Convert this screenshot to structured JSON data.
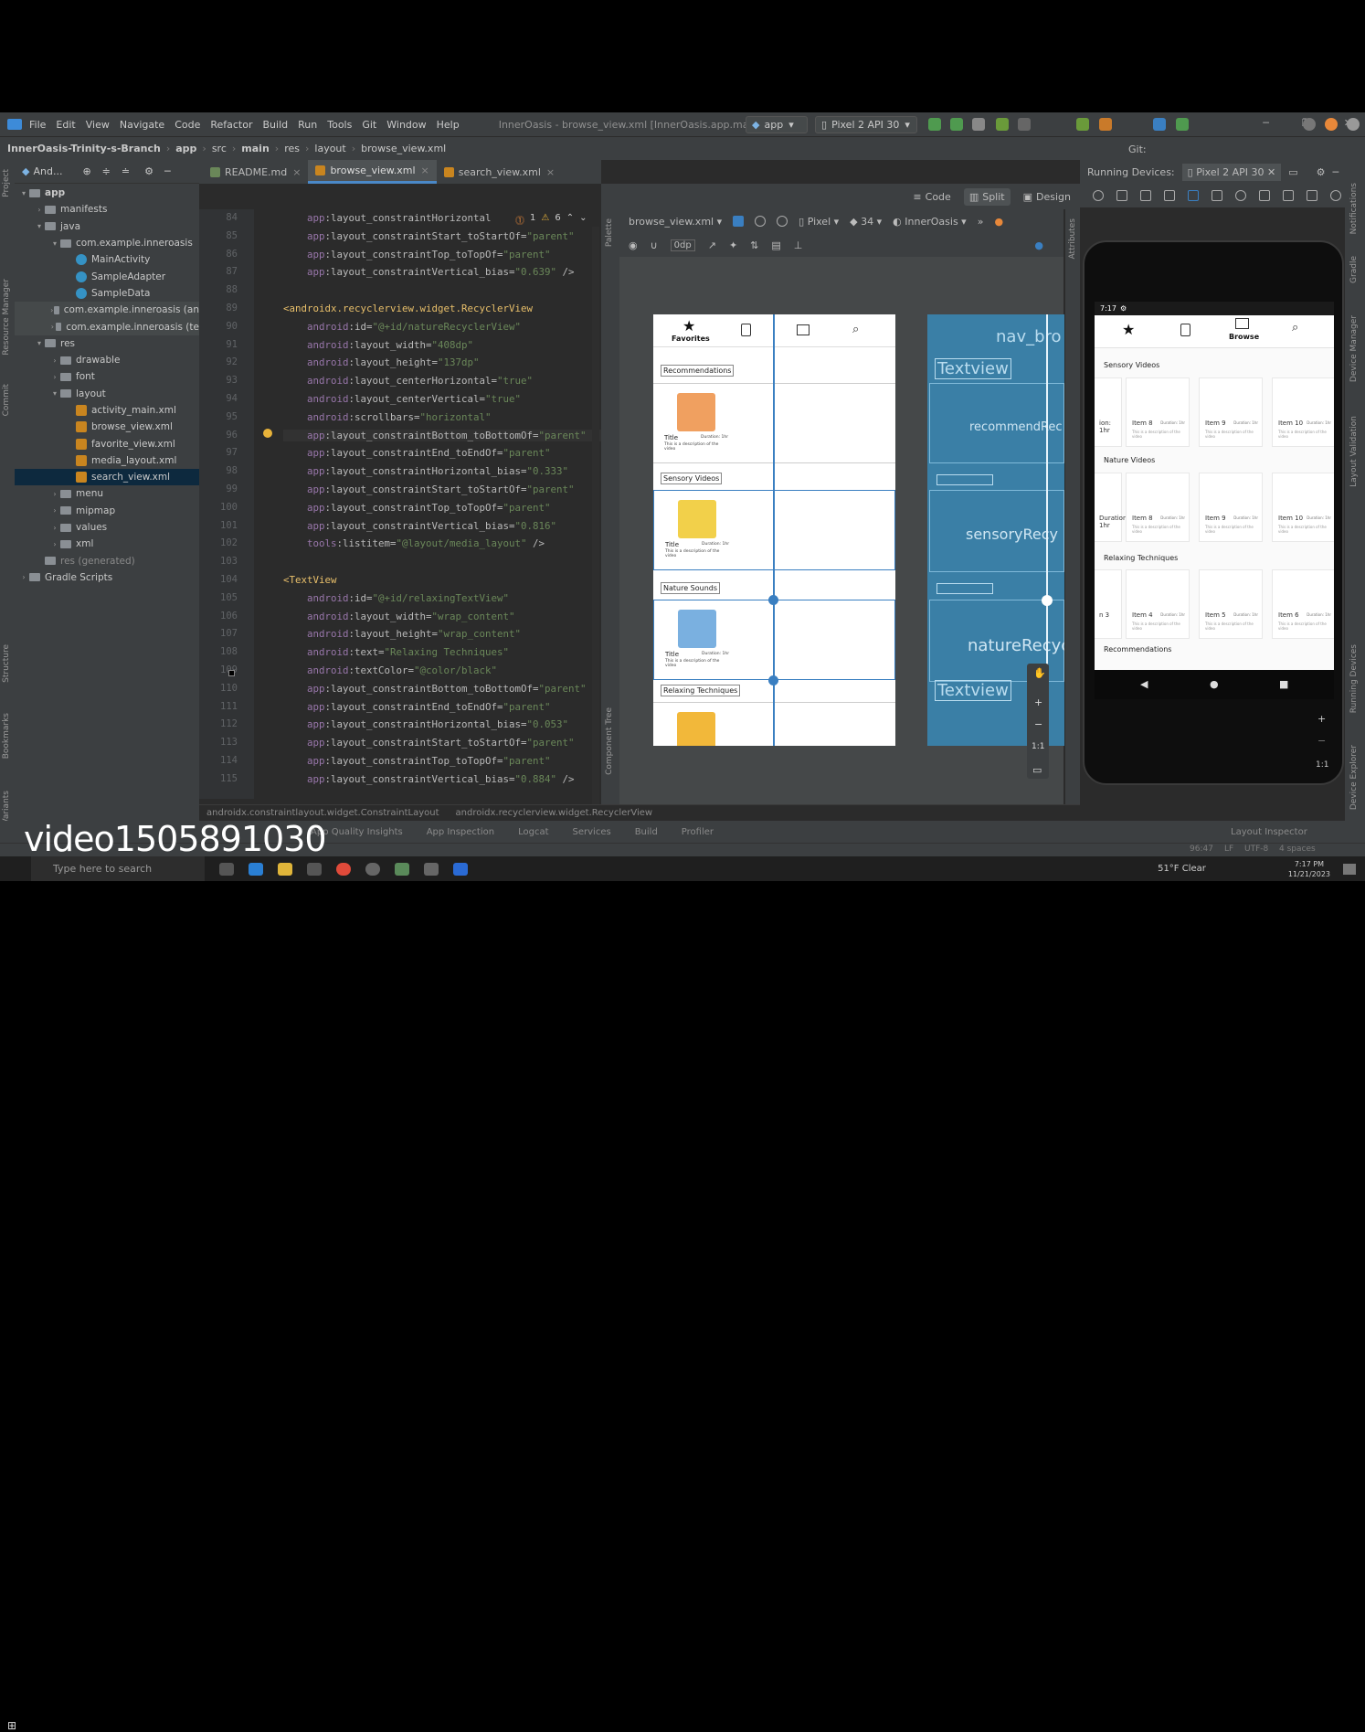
{
  "menu": {
    "items": [
      "File",
      "Edit",
      "View",
      "Navigate",
      "Code",
      "Refactor",
      "Build",
      "Run",
      "Tools",
      "Git",
      "Window",
      "Help"
    ],
    "window_title": "InnerOasis - browse_view.xml [InnerOasis.app.main]"
  },
  "nav": {
    "crumbs": [
      "InnerOasis-Trinity-s-Branch",
      "app",
      "src",
      "main",
      "res",
      "layout",
      "browse_view.xml"
    ],
    "run_config": "app",
    "device": "Pixel 2 API 30",
    "git": "Git:"
  },
  "project": {
    "header": "And...",
    "items": [
      {
        "label": "app",
        "depth": 0,
        "arrow": "v",
        "type": "folder",
        "bold": true
      },
      {
        "label": "manifests",
        "depth": 1,
        "arrow": ">",
        "type": "folder"
      },
      {
        "label": "java",
        "depth": 1,
        "arrow": "v",
        "type": "folder"
      },
      {
        "label": "com.example.inneroasis",
        "depth": 2,
        "arrow": "v",
        "type": "folder"
      },
      {
        "label": "MainActivity",
        "depth": 3,
        "arrow": "",
        "type": "class"
      },
      {
        "label": "SampleAdapter",
        "depth": 3,
        "arrow": "",
        "type": "class"
      },
      {
        "label": "SampleData",
        "depth": 3,
        "arrow": "",
        "type": "class"
      },
      {
        "label": "com.example.inneroasis (an",
        "depth": 2,
        "arrow": ">",
        "type": "folder",
        "hl": true
      },
      {
        "label": "com.example.inneroasis (te",
        "depth": 2,
        "arrow": ">",
        "type": "folder",
        "hl": true
      },
      {
        "label": "res",
        "depth": 1,
        "arrow": "v",
        "type": "folder"
      },
      {
        "label": "drawable",
        "depth": 2,
        "arrow": ">",
        "type": "folder"
      },
      {
        "label": "font",
        "depth": 2,
        "arrow": ">",
        "type": "folder"
      },
      {
        "label": "layout",
        "depth": 2,
        "arrow": "v",
        "type": "folder"
      },
      {
        "label": "activity_main.xml",
        "depth": 3,
        "arrow": "",
        "type": "xml"
      },
      {
        "label": "browse_view.xml",
        "depth": 3,
        "arrow": "",
        "type": "xml"
      },
      {
        "label": "favorite_view.xml",
        "depth": 3,
        "arrow": "",
        "type": "xml"
      },
      {
        "label": "media_layout.xml",
        "depth": 3,
        "arrow": "",
        "type": "xml"
      },
      {
        "label": "search_view.xml",
        "depth": 3,
        "arrow": "",
        "type": "xml",
        "sel": true
      },
      {
        "label": "menu",
        "depth": 2,
        "arrow": ">",
        "type": "folder"
      },
      {
        "label": "mipmap",
        "depth": 2,
        "arrow": ">",
        "type": "folder"
      },
      {
        "label": "values",
        "depth": 2,
        "arrow": ">",
        "type": "folder"
      },
      {
        "label": "xml",
        "depth": 2,
        "arrow": ">",
        "type": "folder"
      },
      {
        "label": "res (generated)",
        "depth": 1,
        "arrow": "",
        "type": "folder",
        "dim": true
      },
      {
        "label": "Gradle Scripts",
        "depth": 0,
        "arrow": ">",
        "type": "folder"
      }
    ]
  },
  "tabs": [
    {
      "label": "README.md",
      "active": false
    },
    {
      "label": "browse_view.xml",
      "active": true
    },
    {
      "label": "search_view.xml",
      "active": false
    }
  ],
  "warnings": {
    "errors": "1",
    "warns": "6"
  },
  "code": [
    {
      "n": "84",
      "parts": [
        [
          "ns",
          "    app"
        ],
        [
          "at",
          ":layout_constraintHorizontal"
        ]
      ]
    },
    {
      "n": "85",
      "parts": [
        [
          "ns",
          "    app"
        ],
        [
          "at",
          ":layout_constraintStart_toStartOf="
        ],
        [
          "vl",
          "\"parent\""
        ]
      ]
    },
    {
      "n": "86",
      "parts": [
        [
          "ns",
          "    app"
        ],
        [
          "at",
          ":layout_constraintTop_toTopOf="
        ],
        [
          "vl",
          "\"parent\""
        ]
      ]
    },
    {
      "n": "87",
      "parts": [
        [
          "ns",
          "    app"
        ],
        [
          "at",
          ":layout_constraintVertical_bias="
        ],
        [
          "vl",
          "\"0.639\""
        ],
        [
          "at",
          " />"
        ]
      ]
    },
    {
      "n": "88",
      "parts": [
        [
          "at",
          ""
        ]
      ]
    },
    {
      "n": "89",
      "parts": [
        [
          "tg",
          "<androidx.recyclerview.widget.RecyclerView"
        ]
      ]
    },
    {
      "n": "90",
      "parts": [
        [
          "ns",
          "    android"
        ],
        [
          "at",
          ":id="
        ],
        [
          "vl",
          "\"@+id/natureRecyclerView\""
        ]
      ]
    },
    {
      "n": "91",
      "parts": [
        [
          "ns",
          "    android"
        ],
        [
          "at",
          ":layout_width="
        ],
        [
          "vl",
          "\"408dp\""
        ]
      ]
    },
    {
      "n": "92",
      "parts": [
        [
          "ns",
          "    android"
        ],
        [
          "at",
          ":layout_height="
        ],
        [
          "vl",
          "\"137dp\""
        ]
      ]
    },
    {
      "n": "93",
      "parts": [
        [
          "ns",
          "    android"
        ],
        [
          "at",
          ":layout_centerHorizontal="
        ],
        [
          "vl",
          "\"true\""
        ]
      ]
    },
    {
      "n": "94",
      "parts": [
        [
          "ns",
          "    android"
        ],
        [
          "at",
          ":layout_centerVertical="
        ],
        [
          "vl",
          "\"true\""
        ]
      ]
    },
    {
      "n": "95",
      "parts": [
        [
          "ns",
          "    android"
        ],
        [
          "at",
          ":scrollbars="
        ],
        [
          "vl",
          "\"horizontal\""
        ]
      ]
    },
    {
      "n": "96",
      "parts": [
        [
          "ns",
          "    app"
        ],
        [
          "at",
          ":layout_constraintBottom_toBottomOf="
        ],
        [
          "vl",
          "\"parent\""
        ]
      ],
      "cur": true
    },
    {
      "n": "97",
      "parts": [
        [
          "ns",
          "    app"
        ],
        [
          "at",
          ":layout_constraintEnd_toEndOf="
        ],
        [
          "vl",
          "\"parent\""
        ]
      ]
    },
    {
      "n": "98",
      "parts": [
        [
          "ns",
          "    app"
        ],
        [
          "at",
          ":layout_constraintHorizontal_bias="
        ],
        [
          "vl",
          "\"0.333\""
        ]
      ]
    },
    {
      "n": "99",
      "parts": [
        [
          "ns",
          "    app"
        ],
        [
          "at",
          ":layout_constraintStart_toStartOf="
        ],
        [
          "vl",
          "\"parent\""
        ]
      ]
    },
    {
      "n": "100",
      "parts": [
        [
          "ns",
          "    app"
        ],
        [
          "at",
          ":layout_constraintTop_toTopOf="
        ],
        [
          "vl",
          "\"parent\""
        ]
      ]
    },
    {
      "n": "101",
      "parts": [
        [
          "ns",
          "    app"
        ],
        [
          "at",
          ":layout_constraintVertical_bias="
        ],
        [
          "vl",
          "\"0.816\""
        ]
      ]
    },
    {
      "n": "102",
      "parts": [
        [
          "ns",
          "    tools"
        ],
        [
          "at",
          ":listitem="
        ],
        [
          "vl",
          "\"@layout/media_layout\""
        ],
        [
          "at",
          " />"
        ]
      ]
    },
    {
      "n": "103",
      "parts": [
        [
          "at",
          ""
        ]
      ]
    },
    {
      "n": "104",
      "parts": [
        [
          "tg",
          "<TextView"
        ]
      ]
    },
    {
      "n": "105",
      "parts": [
        [
          "ns",
          "    android"
        ],
        [
          "at",
          ":id="
        ],
        [
          "vl",
          "\"@+id/relaxingTextView\""
        ]
      ]
    },
    {
      "n": "106",
      "parts": [
        [
          "ns",
          "    android"
        ],
        [
          "at",
          ":layout_width="
        ],
        [
          "vl",
          "\"wrap_content\""
        ]
      ]
    },
    {
      "n": "107",
      "parts": [
        [
          "ns",
          "    android"
        ],
        [
          "at",
          ":layout_height="
        ],
        [
          "vl",
          "\"wrap_content\""
        ]
      ]
    },
    {
      "n": "108",
      "parts": [
        [
          "ns",
          "    android"
        ],
        [
          "at",
          ":text="
        ],
        [
          "vl",
          "\"Relaxing Techniques\""
        ]
      ]
    },
    {
      "n": "109",
      "parts": [
        [
          "ns",
          "    android"
        ],
        [
          "at",
          ":textColor="
        ],
        [
          "vl",
          "\"@color/black\""
        ]
      ]
    },
    {
      "n": "110",
      "parts": [
        [
          "ns",
          "    app"
        ],
        [
          "at",
          ":layout_constraintBottom_toBottomOf="
        ],
        [
          "vl",
          "\"parent\""
        ]
      ]
    },
    {
      "n": "111",
      "parts": [
        [
          "ns",
          "    app"
        ],
        [
          "at",
          ":layout_constraintEnd_toEndOf="
        ],
        [
          "vl",
          "\"parent\""
        ]
      ]
    },
    {
      "n": "112",
      "parts": [
        [
          "ns",
          "    app"
        ],
        [
          "at",
          ":layout_constraintHorizontal_bias="
        ],
        [
          "vl",
          "\"0.053\""
        ]
      ]
    },
    {
      "n": "113",
      "parts": [
        [
          "ns",
          "    app"
        ],
        [
          "at",
          ":layout_constraintStart_toStartOf="
        ],
        [
          "vl",
          "\"parent\""
        ]
      ]
    },
    {
      "n": "114",
      "parts": [
        [
          "ns",
          "    app"
        ],
        [
          "at",
          ":layout_constraintTop_toTopOf="
        ],
        [
          "vl",
          "\"parent\""
        ]
      ]
    },
    {
      "n": "115",
      "parts": [
        [
          "ns",
          "    app"
        ],
        [
          "at",
          ":layout_constraintVertical_bias="
        ],
        [
          "vl",
          "\"0.884\""
        ],
        [
          "at",
          " />"
        ]
      ]
    }
  ],
  "design": {
    "modes": [
      "Code",
      "Split",
      "Design"
    ],
    "file": "browse_view.xml",
    "device": "Pixel",
    "api": "34",
    "theme": "InnerOasis",
    "margin": "0dp",
    "palette": "Palette",
    "tree": "Component Tree",
    "nav_favorites": "Favorites",
    "sections": [
      "Recommendations",
      "Sensory Videos",
      "Nature Sounds",
      "Relaxing Techniques"
    ],
    "card_title": "Title",
    "card_duration": "Duration: 1hr",
    "card_desc": "This is a description of the video",
    "bp_labels": [
      "nav_bro",
      "Textview",
      "recommendRec",
      "sensoryRecy",
      "natureRecyc",
      "Textview"
    ],
    "zoom": "1:1"
  },
  "running": {
    "title": "Running Devices:",
    "device": "Pixel 2 API 30",
    "time": "7:17",
    "browse": "Browse",
    "sections": [
      "Sensory Videos",
      "Nature Videos",
      "Relaxing Techniques",
      "Recommendations"
    ],
    "rows": [
      [
        "Item 8",
        "Item 9",
        "Item 10"
      ],
      [
        "Item 8",
        "Item 9",
        "Item 10"
      ],
      [
        "Item 4",
        "Item 5",
        "Item 6"
      ]
    ],
    "partial_left": [
      "ion: 1hr",
      "Duration: 1hr",
      "n 3"
    ],
    "duration": "Duration: 1hr",
    "desc": "This is a description of the video"
  },
  "bottom": {
    "crumbs": [
      "androidx.constraintlayout.widget.ConstraintLayout",
      "androidx.recyclerview.widget.RecyclerView"
    ],
    "tools": [
      "App Quality Insights",
      "App Inspection",
      "Logcat",
      "Services",
      "Build",
      "Profiler",
      "Layout Inspector"
    ],
    "status": {
      "pos": "96:47",
      "lf": "LF",
      "enc": "UTF-8",
      "indent": "4 spaces"
    }
  },
  "taskbar": {
    "search": "Type here to search",
    "weather": "51°F  Clear",
    "time": "7:17 PM",
    "date": "11/21/2023"
  },
  "overlay": "video1505891030",
  "colors": {
    "accent": "#4a88c7",
    "blueprint": "#3a7fa6",
    "bg": "#2b2b2b",
    "panel": "#3c3f41"
  }
}
